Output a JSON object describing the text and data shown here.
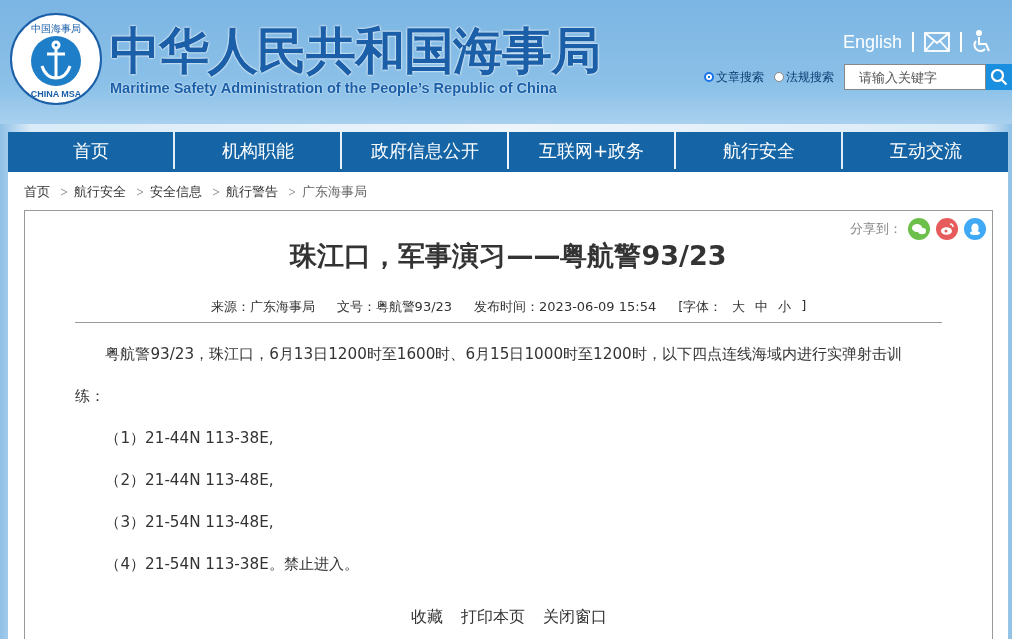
{
  "header": {
    "logo": {
      "ring_text": "中国海事局",
      "badge_text": "CHINA MSA"
    },
    "title": "中华人民共和国海事局",
    "subtitle": "Maritime Safety Administration of the People’s Republic of China",
    "language_link": "English",
    "search_scopes": [
      {
        "label": "文章搜索",
        "selected": true
      },
      {
        "label": "法规搜索",
        "selected": false
      }
    ],
    "search": {
      "placeholder": "请输入关键字"
    }
  },
  "nav": [
    {
      "label": "首页"
    },
    {
      "label": "机构职能"
    },
    {
      "label": "政府信息公开"
    },
    {
      "label": "互联网+政务"
    },
    {
      "label": "航行安全"
    },
    {
      "label": "互动交流"
    }
  ],
  "breadcrumb": [
    "首页",
    "航行安全",
    "安全信息",
    "航行警告",
    "广东海事局"
  ],
  "article": {
    "share_label": "分享到：",
    "title": "珠江口，军事演习——粤航警93/23",
    "source": "来源：广东海事局",
    "doc_number": "文号：粤航警93/23",
    "published": "发布时间：2023-06-09 15:54",
    "font_size": {
      "label": "[字体：",
      "options": [
        "大",
        "中",
        "小"
      ],
      "close": "]"
    },
    "paragraphs": [
      {
        "kind": "lead",
        "text": "粤航警93/23，珠江口，6月13日1200时至1600时、6月15日1000时至1200时，以下四点连线海域内进行实弹射击训练："
      },
      {
        "kind": "point",
        "text": "（1）21-44N 113-38E,"
      },
      {
        "kind": "point",
        "text": "（2）21-44N 113-48E,"
      },
      {
        "kind": "point",
        "text": "（3）21-54N 113-48E,"
      },
      {
        "kind": "point",
        "text": "（4）21-54N 113-38E。禁止进入。"
      }
    ],
    "actions": [
      "收藏",
      "打印本页",
      "关闭窗口"
    ]
  }
}
